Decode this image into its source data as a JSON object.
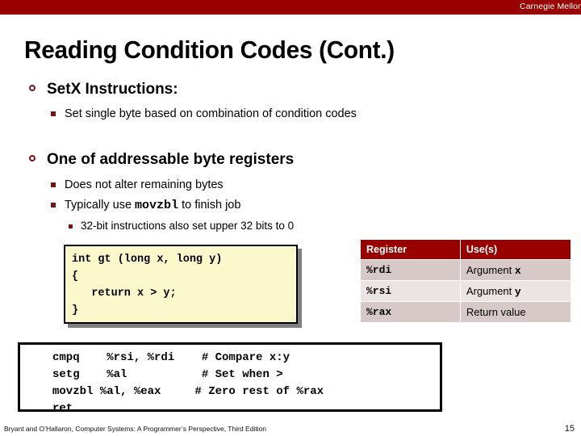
{
  "brand": "Carnegie Mellon",
  "title": "Reading Condition Codes (Cont.)",
  "colors": {
    "accent_red": "#990000",
    "bullet_red": "#7b1113",
    "code_bg": "#fbf8cc",
    "table_row_a": "#d8c9c9",
    "table_row_b": "#ece3e3"
  },
  "bullets": {
    "b1": "SetX Instructions:",
    "b1s1": "Set single byte based on combination of condition codes",
    "b2": "One of addressable byte registers",
    "b2s1": "Does not alter remaining bytes",
    "b2s2_pre": "Typically use ",
    "b2s2_mono": "movzbl",
    "b2s2_post": " to finish job",
    "b2s2s1": "32-bit instructions also set upper 32 bits to 0"
  },
  "c_code": {
    "line1": "int gt (long x, long y)",
    "line2": "{",
    "line3": "   return x > y;",
    "line4": "}"
  },
  "reg_table": {
    "headers": [
      "Register",
      "Use(s)"
    ],
    "rows": [
      {
        "register": "%rdi",
        "use_text": "Argument ",
        "use_var": "x"
      },
      {
        "register": "%rsi",
        "use_text": "Argument ",
        "use_var": "y"
      },
      {
        "register": "%rax",
        "use_text": "Return value",
        "use_var": ""
      }
    ]
  },
  "asm_code": {
    "line1": "cmpq    %rsi, %rdi    # Compare x:y",
    "line2": "setg    %al           # Set when >",
    "line3": "movzbl %al, %eax     # Zero rest of %rax",
    "line4": "ret"
  },
  "footer": {
    "citation": "Bryant and O’Hallaron, Computer Systems: A Programmer’s Perspective, Third Edition",
    "page": "15"
  }
}
